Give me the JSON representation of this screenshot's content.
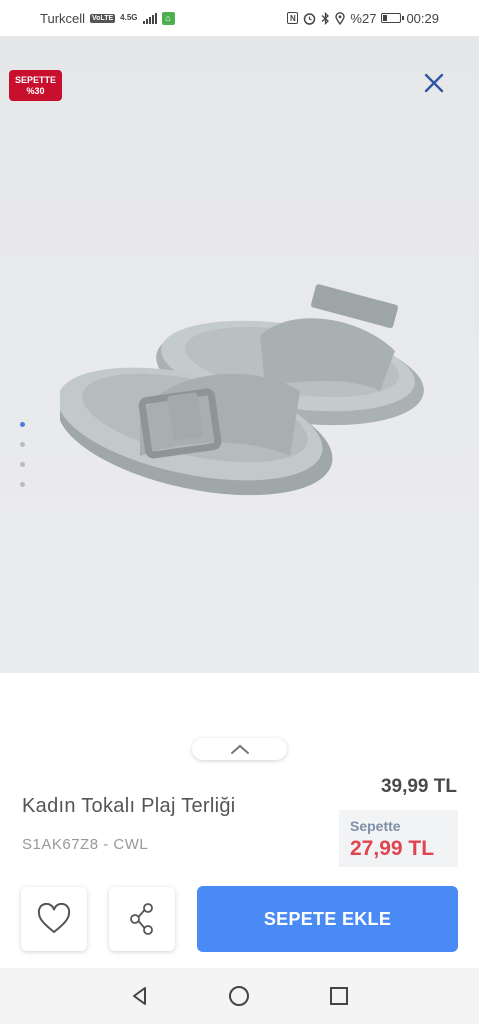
{
  "status_bar": {
    "carrier": "Turkcell",
    "volte": "VoLTE",
    "network": "4.5G",
    "battery_percent": "%27",
    "battery_level": 0.27,
    "time": "00:29"
  },
  "image_area": {
    "discount_badge_line1": "SEPETTE",
    "discount_badge_line2": "%30",
    "close_icon": "close-x-icon",
    "carousel_dot_count": 4,
    "carousel_active_index": 0
  },
  "product": {
    "title": "Kadın Tokalı Plaj Terliği",
    "code": "S1AK67Z8 - CWL",
    "old_price": "39,99 TL",
    "cart_label": "Sepette",
    "cart_price": "27,99 TL"
  },
  "actions": {
    "favorite_icon": "heart-icon",
    "share_icon": "share-icon",
    "add_to_cart_label": "SEPETE EKLE"
  },
  "nav_bar": {
    "back_icon": "back-triangle-icon",
    "home_icon": "home-circle-icon",
    "recents_icon": "recents-square-icon"
  },
  "colors": {
    "accent": "#4a8af4",
    "badge_red": "#c8102e",
    "cart_price_red": "#e0454f",
    "close_icon_blue": "#2f55a4"
  }
}
